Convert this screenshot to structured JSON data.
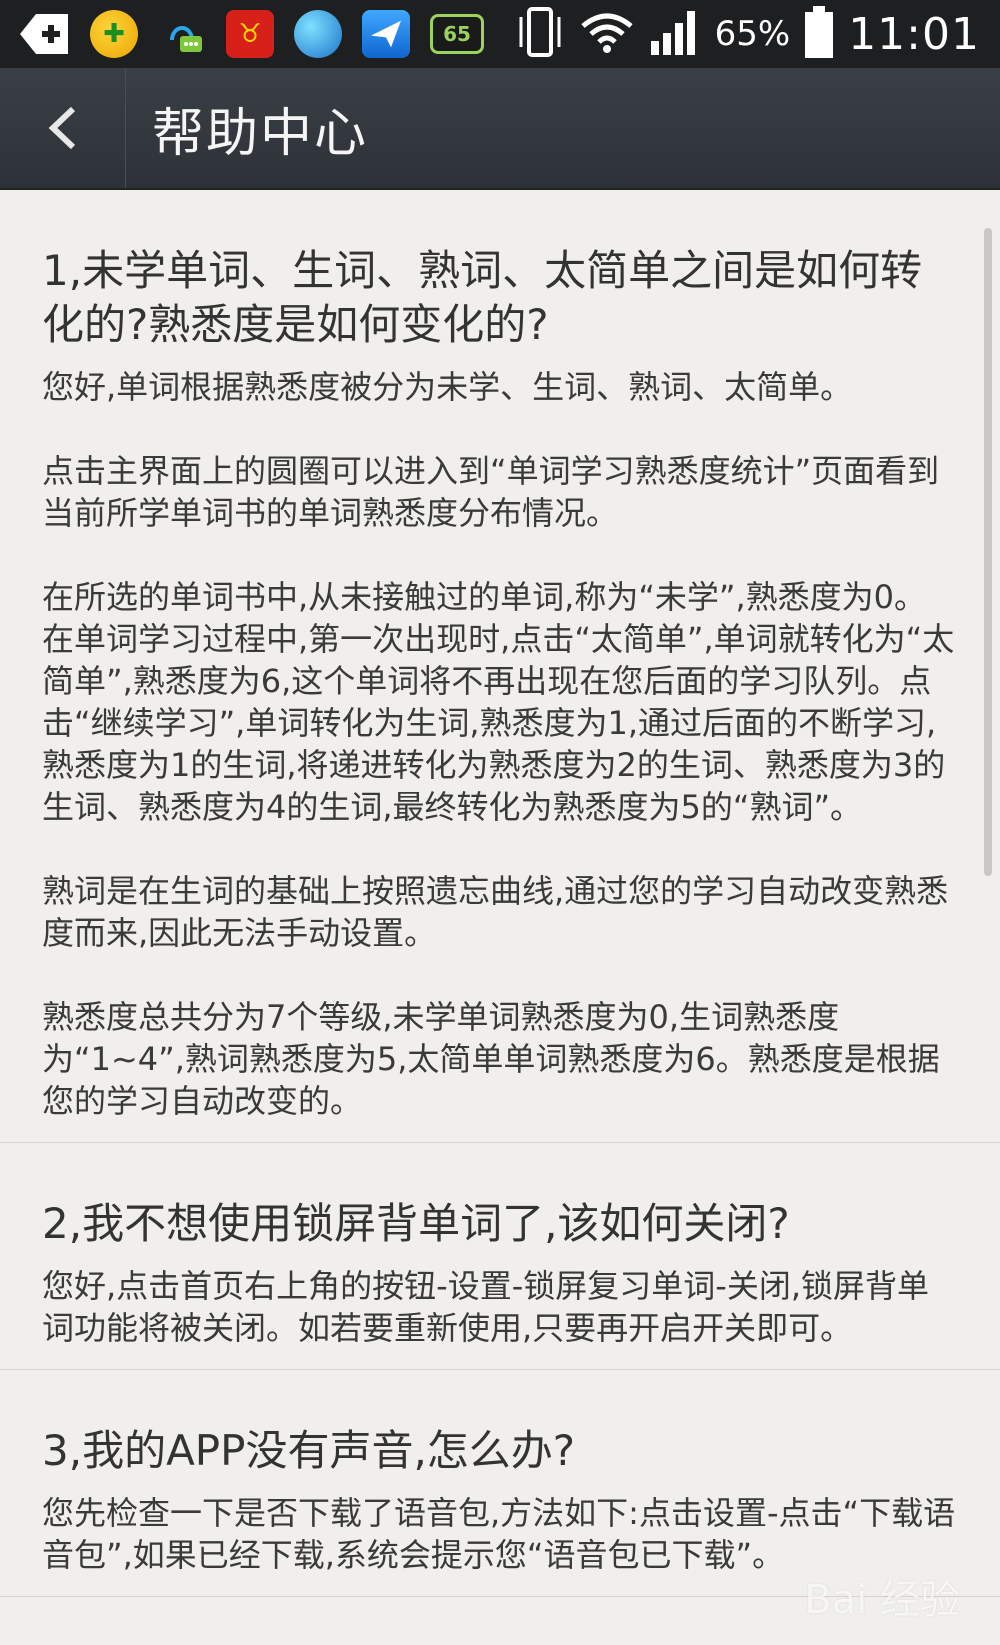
{
  "status_bar": {
    "signal_icons": [
      "back-icon",
      "game-icon",
      "qq-icon",
      "bull-icon",
      "browser-icon",
      "bird-icon",
      "badge-65-icon"
    ],
    "badge_65": "65",
    "battery": "65%",
    "time": "11:01"
  },
  "header": {
    "title": "帮助中心"
  },
  "faq": [
    {
      "question": "1,未学单词、生词、熟词、太简单之间是如何转化的?熟悉度是如何变化的?",
      "answer": [
        "您好,单词根据熟悉度被分为未学、生词、熟词、太简单。",
        "点击主界面上的圆圈可以进入到“单词学习熟悉度统计”页面看到当前所学单词书的单词熟悉度分布情况。",
        "在所选的单词书中,从未接触过的单词,称为“未学”,熟悉度为0。在单词学习过程中,第一次出现时,点击“太简单”,单词就转化为“太简单”,熟悉度为6,这个单词将不再出现在您后面的学习队列。点击“继续学习”,单词转化为生词,熟悉度为1,通过后面的不断学习,熟悉度为1的生词,将递进转化为熟悉度为2的生词、熟悉度为3的生词、熟悉度为4的生词,最终转化为熟悉度为5的“熟词”。",
        "熟词是在生词的基础上按照遗忘曲线,通过您的学习自动改变熟悉度而来,因此无法手动设置。",
        "熟悉度总共分为7个等级,未学单词熟悉度为0,生词熟悉度为“1~4”,熟词熟悉度为5,太简单单词熟悉度为6。熟悉度是根据您的学习自动改变的。"
      ]
    },
    {
      "question": "2,我不想使用锁屏背单词了,该如何关闭?",
      "answer": [
        "您好,点击首页右上角的按钮-设置-锁屏复习单词-关闭,锁屏背单词功能将被关闭。如若要重新使用,只要再开启开关即可。"
      ]
    },
    {
      "question": "3,我的APP没有声音,怎么办?",
      "answer": [
        "您先检查一下是否下载了语音包,方法如下:点击设置-点击“下载语音包”,如果已经下载,系统会提示您“语音包已下载”。"
      ]
    }
  ],
  "watermark": "Bai 经验"
}
